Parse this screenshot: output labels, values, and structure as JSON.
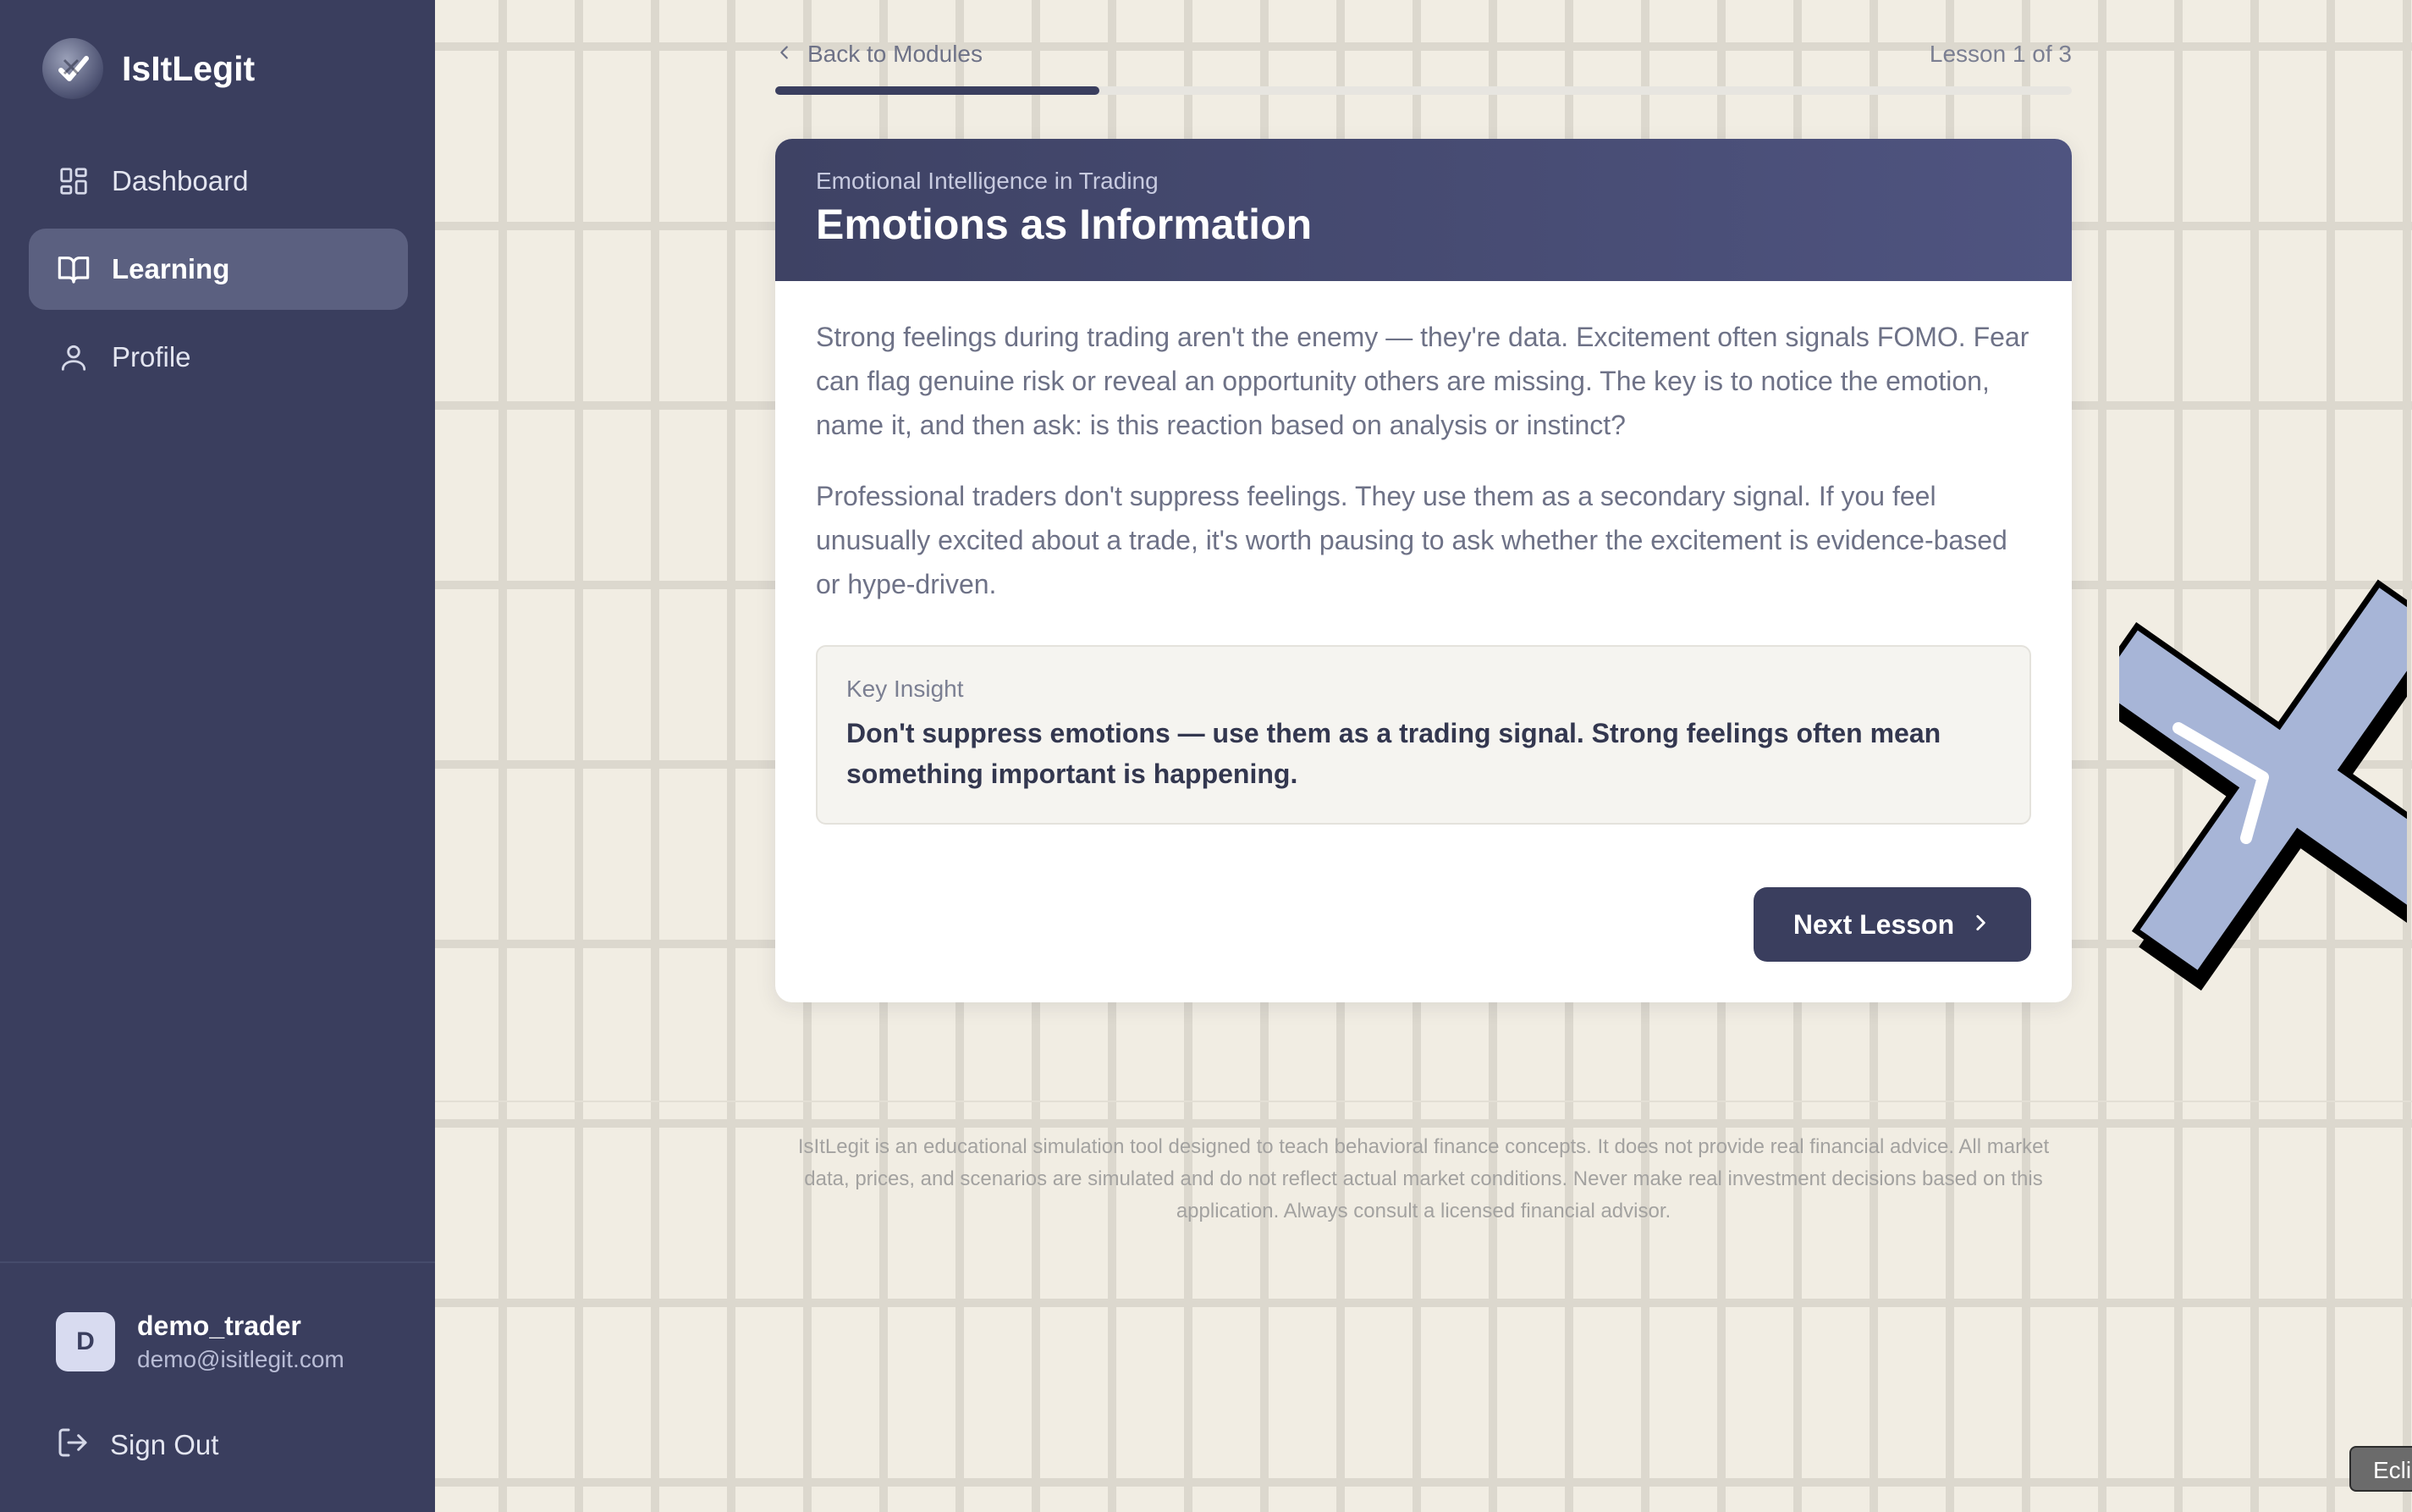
{
  "app": {
    "name": "IsItLegit"
  },
  "sidebar": {
    "items": [
      {
        "label": "Dashboard",
        "icon": "dashboard-grid-icon",
        "active": false
      },
      {
        "label": "Learning",
        "icon": "open-book-icon",
        "active": true
      },
      {
        "label": "Profile",
        "icon": "user-icon",
        "active": false
      }
    ],
    "user": {
      "initial": "D",
      "name": "demo_trader",
      "email": "demo@isitlegit.com"
    },
    "signout_label": "Sign Out"
  },
  "header": {
    "back_label": "Back to Modules",
    "lesson_count": "Lesson 1 of 3",
    "progress": 0.25
  },
  "lesson": {
    "module": "Emotional Intelligence in Trading",
    "title": "Emotions as Information",
    "paragraphs": [
      "Strong feelings during trading aren't the enemy — they're data. Excitement often signals FOMO. Fear can flag genuine risk or reveal an opportunity others are missing. The key is to notice the emotion, name it, and then ask: is this reaction based on analysis or instinct?",
      "Professional traders don't suppress feelings. They use them as a secondary signal. If you feel unusually excited about a trade, it's worth pausing to ask whether the excitement is evidence-based or hype-driven."
    ],
    "insight_label": "Key Insight",
    "insight_text": "Don't suppress emotions — use them as a trading signal. Strong feelings often mean something important is happening.",
    "next_label": "Next Lesson"
  },
  "footer": {
    "disclaimer": "IsItLegit is an educational simulation tool designed to teach behavioral finance concepts. It does not provide real financial advice. All market data, prices, and scenarios are simulated and do not reflect actual market conditions. Never make real investment decisions based on this application. Always consult a licensed financial advisor."
  },
  "tooltip": {
    "text": "Ecli"
  },
  "colors": {
    "sidebar_bg": "#3a3e5e",
    "accent": "#3a3e5e",
    "active_nav": "#5b6080",
    "page_bg": "#f1ede3",
    "deco_fill": "#a7b5d7"
  }
}
